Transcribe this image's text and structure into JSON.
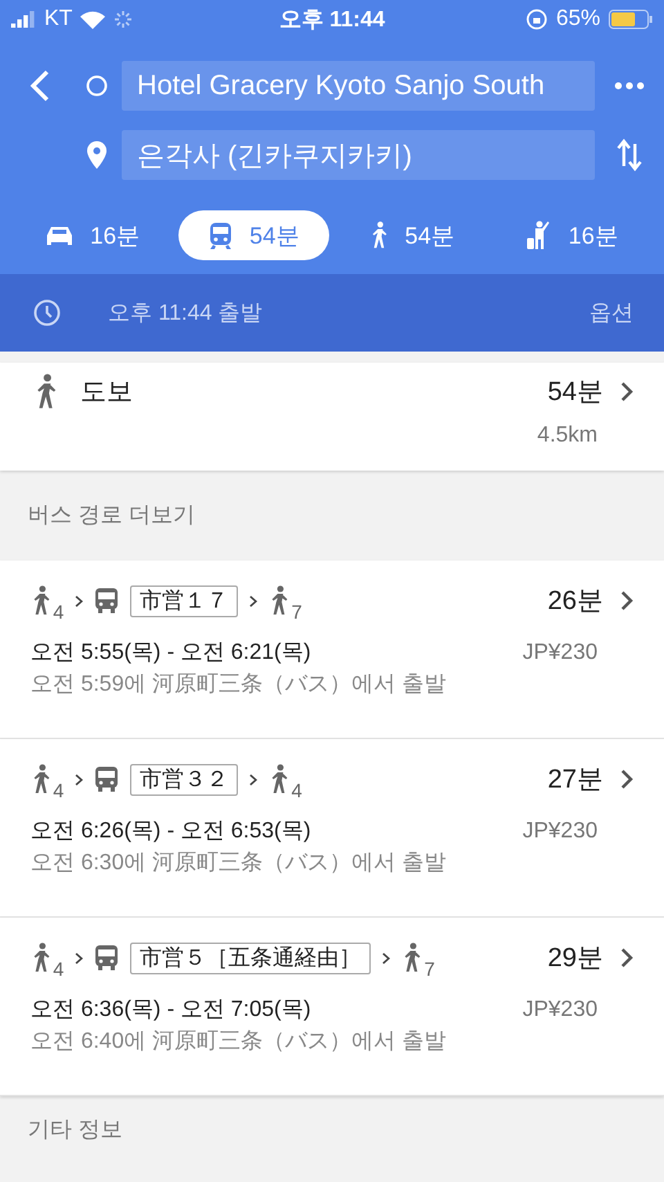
{
  "status_bar": {
    "carrier": "KT",
    "time": "오후 11:44",
    "battery": "65%"
  },
  "search": {
    "origin": "Hotel Gracery Kyoto Sanjo South",
    "destination": "은각사 (긴카쿠지카키)"
  },
  "modes": [
    {
      "kind": "car",
      "label": "16분",
      "selected": false
    },
    {
      "kind": "transit",
      "label": "54분",
      "selected": true
    },
    {
      "kind": "walk",
      "label": "54분",
      "selected": false
    },
    {
      "kind": "ride",
      "label": "16분",
      "selected": false
    }
  ],
  "depart_bar": {
    "time": "오후 11:44 출발",
    "options": "옵션"
  },
  "walk_route": {
    "label": "도보",
    "duration": "54분",
    "distance": "4.5km"
  },
  "bus_section": {
    "title": "버스 경로 더보기"
  },
  "routes": [
    {
      "steps": [
        {
          "kind": "walk",
          "sub": "4"
        },
        {
          "kind": "bus",
          "line": "市営１７"
        },
        {
          "kind": "walk",
          "sub": "7"
        }
      ],
      "duration": "26분",
      "times": "오전 5:55(목) - 오전 6:21(목)",
      "fare": "JP¥230",
      "depart": "오전 5:59에 河原町三条（バス）에서 출발"
    },
    {
      "steps": [
        {
          "kind": "walk",
          "sub": "4"
        },
        {
          "kind": "bus",
          "line": "市営３２"
        },
        {
          "kind": "walk",
          "sub": "4"
        }
      ],
      "duration": "27분",
      "times": "오전 6:26(목) - 오전 6:53(목)",
      "fare": "JP¥230",
      "depart": "오전 6:30에 河原町三条（バス）에서 출발"
    },
    {
      "steps": [
        {
          "kind": "walk",
          "sub": "4"
        },
        {
          "kind": "bus",
          "line": "市営５［五条通経由］"
        },
        {
          "kind": "walk",
          "sub": "7"
        }
      ],
      "duration": "29분",
      "times": "오전 6:36(목) - 오전 7:05(목)",
      "fare": "JP¥230",
      "depart": "오전 6:40에 河原町三条（バス）에서 출발"
    }
  ],
  "other_section": {
    "title": "기타 정보"
  }
}
